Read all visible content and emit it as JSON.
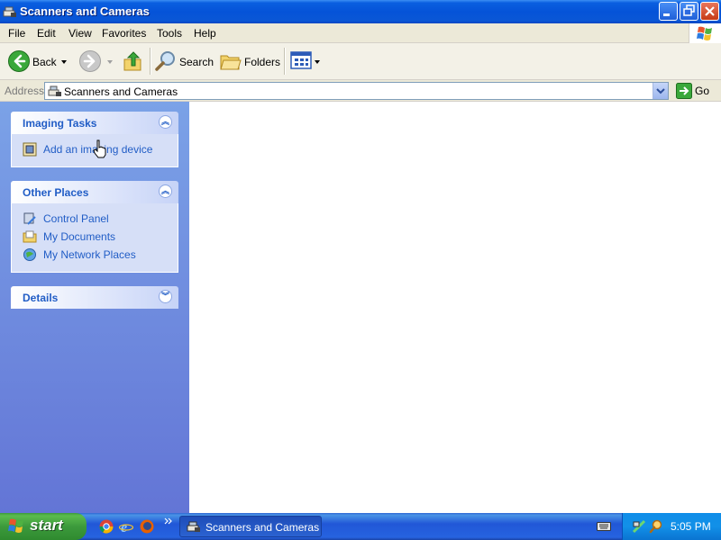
{
  "window": {
    "title": "Scanners and Cameras"
  },
  "menu": [
    "File",
    "Edit",
    "View",
    "Favorites",
    "Tools",
    "Help"
  ],
  "toolbar": {
    "back_label": "Back",
    "search_label": "Search",
    "folders_label": "Folders"
  },
  "address": {
    "label": "Address",
    "value": "Scanners and Cameras",
    "go_label": "Go"
  },
  "tasks": {
    "imaging": {
      "title": "Imaging Tasks",
      "items": [
        "Add an imaging device"
      ]
    },
    "other_places": {
      "title": "Other Places",
      "items": [
        "Control Panel",
        "My Documents",
        "My Network Places"
      ]
    },
    "details": {
      "title": "Details"
    }
  },
  "taskbar": {
    "start_label": "start",
    "active_window": "Scanners and Cameras",
    "clock": "5:05 PM"
  },
  "colors": {
    "title_bar": "#0553d8",
    "task_link": "#215dc6",
    "left_pane_top": "#7ba2e7",
    "start_green": "#3c9a3c"
  }
}
